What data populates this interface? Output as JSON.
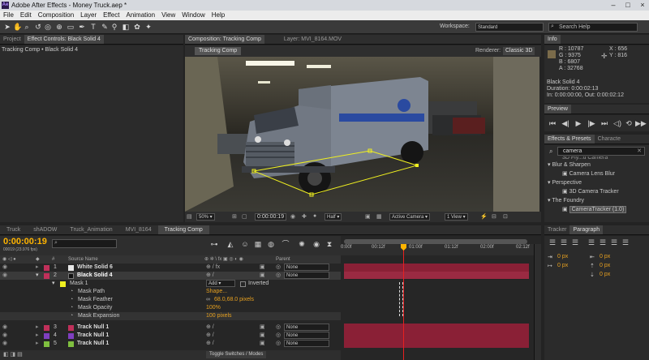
{
  "app": {
    "title": "Adobe After Effects - Money Truck.aep *",
    "logo": "Ae"
  },
  "menu": [
    "File",
    "Edit",
    "Composition",
    "Layer",
    "Effect",
    "Animation",
    "View",
    "Window",
    "Help"
  ],
  "toolbar": {
    "workspace_label": "Workspace:",
    "workspace_value": "Standard",
    "search_placeholder": "Search Help"
  },
  "project_panel": {
    "tab_project": "Project",
    "tab_effect_controls": "Effect Controls: Black Solid 4",
    "breadcrumb": "Tracking Comp • Black Solid 4"
  },
  "composition_panel": {
    "tab_comp": "Composition: Tracking Comp",
    "tab_layer": "Layer: MVI_8164.MOV",
    "comp_name_button": "Tracking Comp",
    "renderer_label": "Renderer:",
    "renderer_value": "Classic 3D",
    "zoom": "50%",
    "timecode": "0:00:00:19",
    "resolution": "Half",
    "camera": "Active Camera",
    "views": "1 View"
  },
  "info_panel": {
    "tab": "Info",
    "r": "R : 10787",
    "g": "G : 9375",
    "b": "B : 6807",
    "a": "A : 32768",
    "x": "X : 656",
    "y": "Y : 816",
    "layer_name": "Black Solid 4",
    "duration": "Duration: 0:00:02:13",
    "in_out": "In: 0:00:00:00, Out: 0:00:02:12"
  },
  "preview_panel": {
    "tab": "Preview"
  },
  "effects_panel": {
    "tab_effects": "Effects & Presets",
    "tab_character": "Characte",
    "search_value": "camera",
    "items": [
      {
        "label": "3D Fly...ū Camera",
        "type": "item"
      },
      {
        "label": "Blur & Sharpen",
        "type": "category"
      },
      {
        "label": "Camera Lens Blur",
        "type": "item"
      },
      {
        "label": "Perspective",
        "type": "category"
      },
      {
        "label": "3D Camera Tracker",
        "type": "item"
      },
      {
        "label": "The Foundry",
        "type": "category"
      },
      {
        "label": "CameraTracker (1.0)",
        "type": "item-selected"
      }
    ]
  },
  "tracker_panel": {
    "tab_tracker": "Tracker",
    "tab_paragraph": "Paragraph",
    "px_values": [
      "0 px",
      "0 px",
      "0 px",
      "0 px",
      "0 px"
    ]
  },
  "timeline": {
    "tabs": [
      "Truck",
      "shADOW",
      "Truck_Animation",
      "MVI_8164",
      "Tracking Comp"
    ],
    "active_tab": "Tracking Comp",
    "current_time": "0:00:00:19",
    "frame_info": "00019 (23.976 fps)",
    "search_placeholder": "",
    "col_hash": "#",
    "col_source": "Source Name",
    "col_parent": "Parent",
    "ruler": [
      "0:00f",
      "00:12f",
      "01:00f",
      "01:12f",
      "02:00f",
      "02:12f"
    ],
    "layers": [
      {
        "num": "1",
        "name": "White Solid 6",
        "color": "#e8e8e8",
        "parent": "None"
      },
      {
        "num": "2",
        "name": "Black Solid 4",
        "color": "#111111",
        "parent": "None"
      }
    ],
    "mask": {
      "name": "Mask 1",
      "mode": "Add",
      "inverted_label": "Inverted",
      "props": [
        {
          "label": "Mask Path",
          "value": "Shape..."
        },
        {
          "label": "Mask Feather",
          "value": "68.0,68.0 pixels"
        },
        {
          "label": "Mask Opacity",
          "value": "100%"
        },
        {
          "label": "Mask Expansion",
          "value": "100 pixels"
        }
      ]
    },
    "null_layers": [
      {
        "num": "3",
        "name": "Track Null 1",
        "color": "#c0305a",
        "parent": "None"
      },
      {
        "num": "4",
        "name": "Track Null 1",
        "color": "#7f3fbf",
        "parent": "None"
      },
      {
        "num": "5",
        "name": "Track Null 1",
        "color": "#7fbf3f",
        "parent": "None"
      }
    ],
    "toggle_label": "Toggle Switches / Modes",
    "playhead_fraction": 0.32
  },
  "colors": {
    "accent": "#ffb400",
    "track_bar": "#8a2036",
    "mask_yellow": "#f0f020"
  }
}
